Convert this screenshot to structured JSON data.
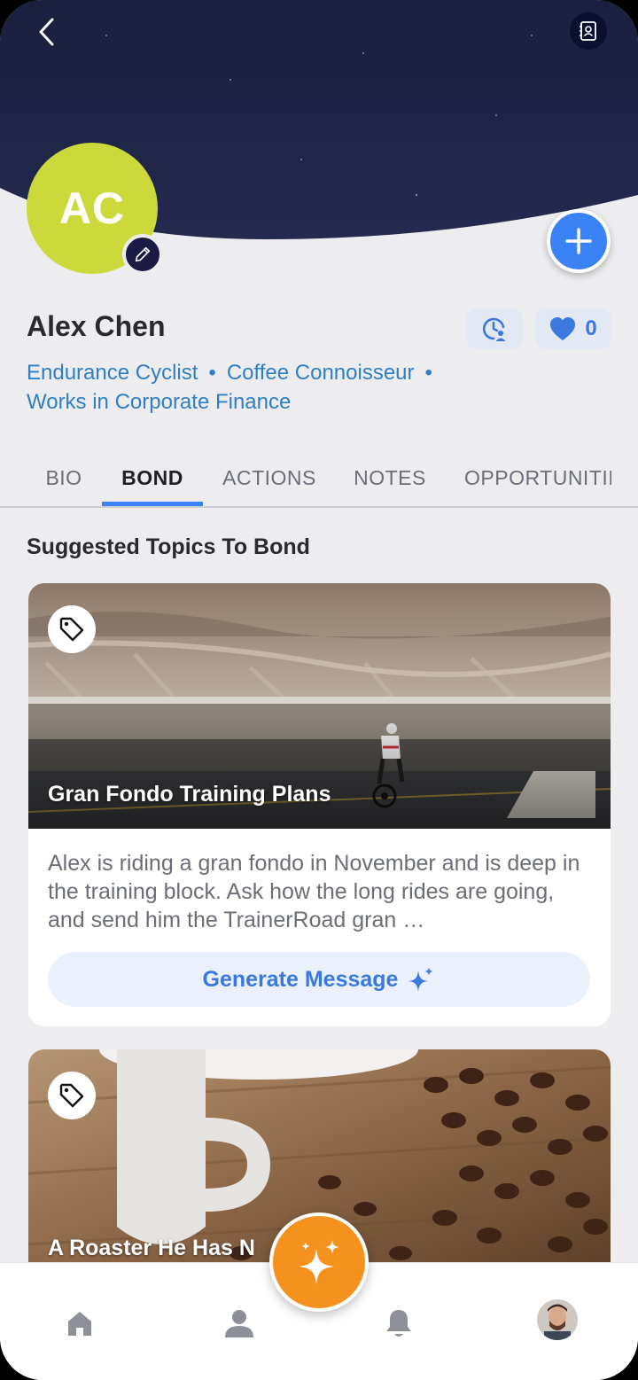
{
  "profile": {
    "initials": "AC",
    "name": "Alex Chen",
    "tags": [
      "Endurance Cyclist",
      "Coffee Connoisseur",
      "Works in Corporate Finance"
    ],
    "tag_separator": "•",
    "like_count": "0"
  },
  "tabs": [
    "BIO",
    "BOND",
    "ACTIONS",
    "NOTES",
    "OPPORTUNITII"
  ],
  "active_tab": "BOND",
  "section_title": "Suggested Topics To Bond",
  "cards": [
    {
      "title": "Gran Fondo Training Plans",
      "description": "Alex is riding a gran fondo in November and is deep in the training block. Ask how the long rides are going, and send him the TrainerRoad gran …",
      "button_label": "Generate Message",
      "icon": "tag-icon"
    },
    {
      "title": "A Roaster He Has N",
      "icon": "tag-icon"
    }
  ],
  "nav": [
    "home-icon",
    "person-icon",
    "bell-icon",
    "user-avatar"
  ],
  "colors": {
    "accent": "#3b82f6",
    "link": "#2f7fc6",
    "avatar": "#cbd93a",
    "ai_fab": "#f5921e",
    "header": "#151a3a"
  }
}
